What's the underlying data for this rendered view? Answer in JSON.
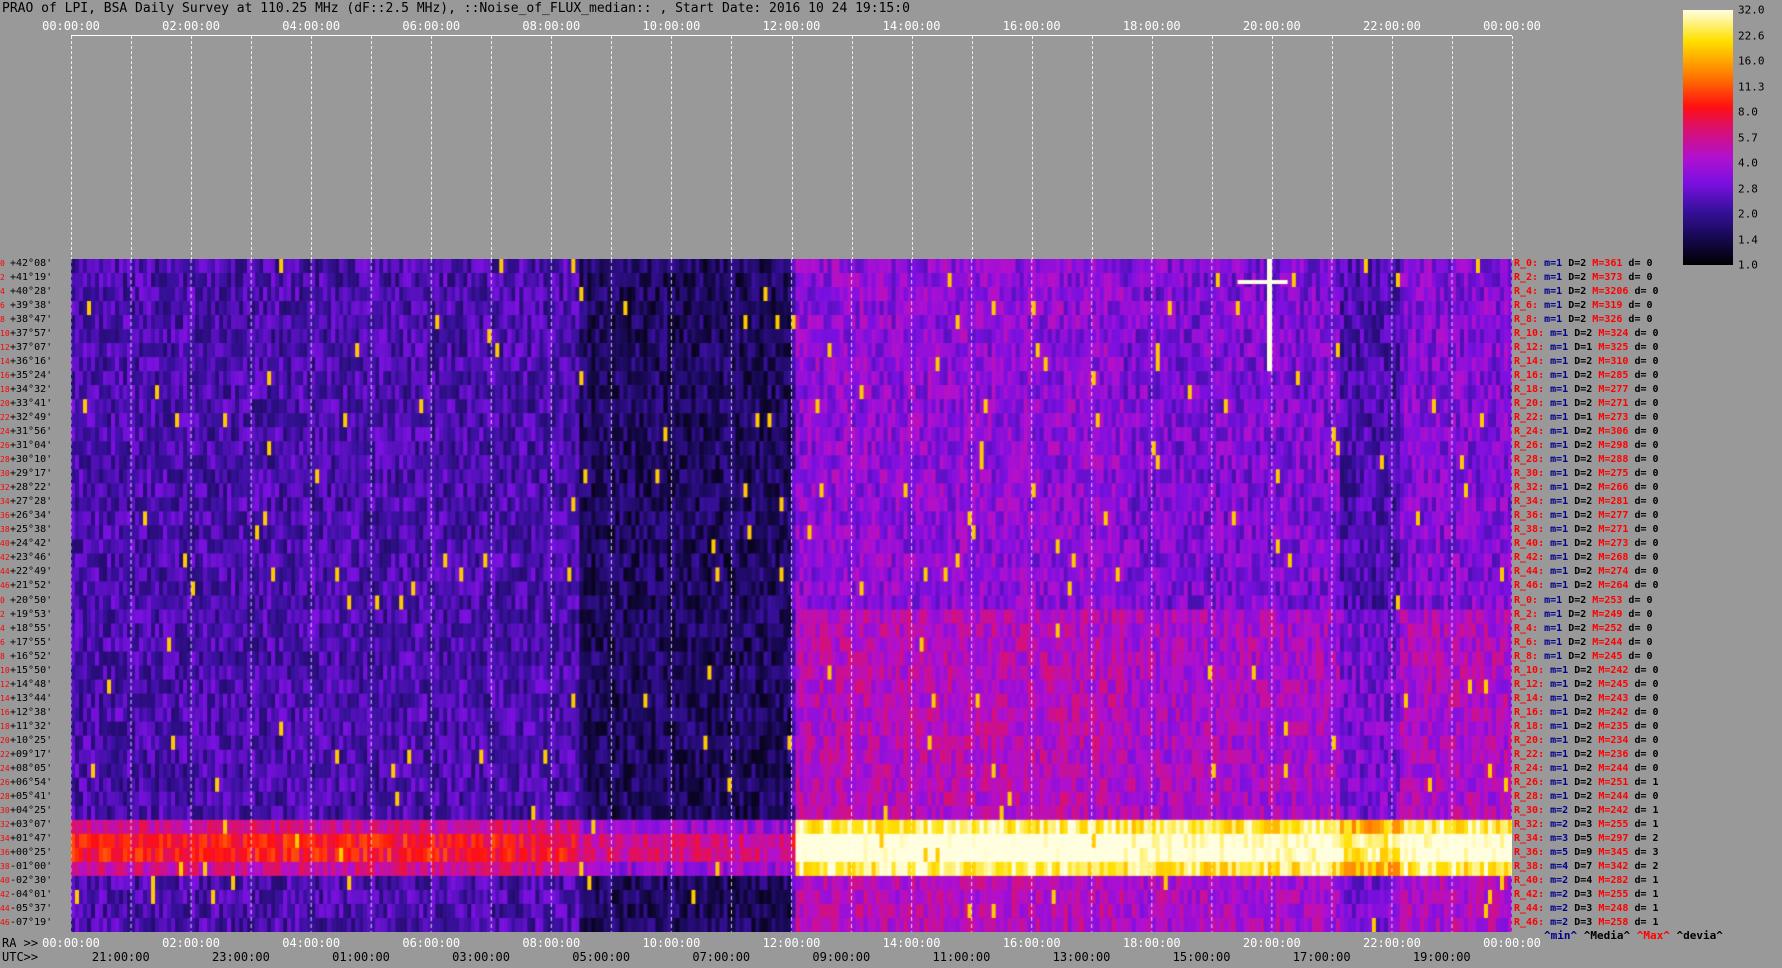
{
  "title": "PRAO of LPI, BSA Daily Survey at 110.25 MHz (dF::2.5 MHz), ::Noise_of_FLUX_median:: , Start Date: 2016 10 24 19:15:0",
  "chart_data": {
    "type": "heatmap",
    "x_ra_ticks": [
      "00:00:00",
      "02:00:00",
      "04:00:00",
      "06:00:00",
      "08:00:00",
      "10:00:00",
      "12:00:00",
      "14:00:00",
      "16:00:00",
      "18:00:00",
      "20:00:00",
      "22:00:00",
      "00:00:00"
    ],
    "x_utc_ticks": [
      "21:00:00",
      "23:00:00",
      "01:00:00",
      "03:00:00",
      "05:00:00",
      "07:00:00",
      "09:00:00",
      "11:00:00",
      "13:00:00",
      "15:00:00",
      "17:00:00",
      "19:00:00"
    ],
    "ra_label": "RA >>",
    "utc_label": "UTC>>",
    "declinations": [
      "+42°08'",
      "+41°19'",
      "+40°28'",
      "+39°38'",
      "+38°47'",
      "+37°57'",
      "+37°07'",
      "+36°16'",
      "+35°24'",
      "+34°32'",
      "+33°41'",
      "+32°49'",
      "+31°56'",
      "+31°04'",
      "+30°10'",
      "+29°17'",
      "+28°22'",
      "+27°28'",
      "+26°34'",
      "+25°38'",
      "+24°42'",
      "+23°46'",
      "+22°49'",
      "+21°52'",
      "+20°50'",
      "+19°53'",
      "+18°55'",
      "+17°55'",
      "+16°52'",
      "+15°50'",
      "+14°48'",
      "+13°44'",
      "+12°38'",
      "+11°32'",
      "+10°25'",
      "+09°17'",
      "+08°05'",
      "+06°54'",
      "+05°41'",
      "+04°25'",
      "+03°07'",
      "+01°47'",
      "+00°25'",
      "-01°00'",
      "-02°30'",
      "-04°01'",
      "-05°37'",
      "-07°19'"
    ],
    "row_numbers": [
      "0",
      "2",
      "4",
      "6",
      "8",
      "10",
      "12",
      "14",
      "16",
      "18",
      "20",
      "22",
      "24",
      "26",
      "28",
      "30",
      "32",
      "34",
      "36",
      "38",
      "40",
      "42",
      "44",
      "46",
      "0",
      "2",
      "4",
      "6",
      "8",
      "10",
      "12",
      "14",
      "16",
      "18",
      "20",
      "22",
      "24",
      "26",
      "28",
      "30",
      "32",
      "34",
      "36",
      "38",
      "40",
      "42",
      "44",
      "46"
    ],
    "row_stats": [
      {
        "r": "R_0:",
        "m": "m=1",
        "d": "D=2",
        "M": "M=361",
        "dev": "d= 0"
      },
      {
        "r": "R_2:",
        "m": "m=1",
        "d": "D=2",
        "M": "M=373",
        "dev": "d= 0"
      },
      {
        "r": "R_4:",
        "m": "m=1",
        "d": "D=2",
        "M": "M=3206",
        "dev": "d= 0"
      },
      {
        "r": "R_6:",
        "m": "m=1",
        "d": "D=2",
        "M": "M=319",
        "dev": "d= 0"
      },
      {
        "r": "R_8:",
        "m": "m=1",
        "d": "D=2",
        "M": "M=326",
        "dev": "d= 0"
      },
      {
        "r": "R_10:",
        "m": "m=1",
        "d": "D=2",
        "M": "M=324",
        "dev": "d= 0"
      },
      {
        "r": "R_12:",
        "m": "m=1",
        "d": "D=1",
        "M": "M=325",
        "dev": "d= 0"
      },
      {
        "r": "R_14:",
        "m": "m=1",
        "d": "D=2",
        "M": "M=310",
        "dev": "d= 0"
      },
      {
        "r": "R_16:",
        "m": "m=1",
        "d": "D=2",
        "M": "M=285",
        "dev": "d= 0"
      },
      {
        "r": "R_18:",
        "m": "m=1",
        "d": "D=2",
        "M": "M=277",
        "dev": "d= 0"
      },
      {
        "r": "R_20:",
        "m": "m=1",
        "d": "D=2",
        "M": "M=271",
        "dev": "d= 0"
      },
      {
        "r": "R_22:",
        "m": "m=1",
        "d": "D=1",
        "M": "M=273",
        "dev": "d= 0"
      },
      {
        "r": "R_24:",
        "m": "m=1",
        "d": "D=2",
        "M": "M=306",
        "dev": "d= 0"
      },
      {
        "r": "R_26:",
        "m": "m=1",
        "d": "D=2",
        "M": "M=298",
        "dev": "d= 0"
      },
      {
        "r": "R_28:",
        "m": "m=1",
        "d": "D=2",
        "M": "M=288",
        "dev": "d= 0"
      },
      {
        "r": "R_30:",
        "m": "m=1",
        "d": "D=2",
        "M": "M=275",
        "dev": "d= 0"
      },
      {
        "r": "R_32:",
        "m": "m=1",
        "d": "D=2",
        "M": "M=266",
        "dev": "d= 0"
      },
      {
        "r": "R_34:",
        "m": "m=1",
        "d": "D=2",
        "M": "M=281",
        "dev": "d= 0"
      },
      {
        "r": "R_36:",
        "m": "m=1",
        "d": "D=2",
        "M": "M=277",
        "dev": "d= 0"
      },
      {
        "r": "R_38:",
        "m": "m=1",
        "d": "D=2",
        "M": "M=271",
        "dev": "d= 0"
      },
      {
        "r": "R_40:",
        "m": "m=1",
        "d": "D=2",
        "M": "M=273",
        "dev": "d= 0"
      },
      {
        "r": "R_42:",
        "m": "m=1",
        "d": "D=2",
        "M": "M=268",
        "dev": "d= 0"
      },
      {
        "r": "R_44:",
        "m": "m=1",
        "d": "D=2",
        "M": "M=274",
        "dev": "d= 0"
      },
      {
        "r": "R_46:",
        "m": "m=1",
        "d": "D=2",
        "M": "M=264",
        "dev": "d= 0"
      },
      {
        "r": "R_0:",
        "m": "m=1",
        "d": "D=2",
        "M": "M=253",
        "dev": "d= 0"
      },
      {
        "r": "R_2:",
        "m": "m=1",
        "d": "D=2",
        "M": "M=249",
        "dev": "d= 0"
      },
      {
        "r": "R_4:",
        "m": "m=1",
        "d": "D=2",
        "M": "M=252",
        "dev": "d= 0"
      },
      {
        "r": "R_6:",
        "m": "m=1",
        "d": "D=2",
        "M": "M=244",
        "dev": "d= 0"
      },
      {
        "r": "R_8:",
        "m": "m=1",
        "d": "D=2",
        "M": "M=245",
        "dev": "d= 0"
      },
      {
        "r": "R_10:",
        "m": "m=1",
        "d": "D=2",
        "M": "M=242",
        "dev": "d= 0"
      },
      {
        "r": "R_12:",
        "m": "m=1",
        "d": "D=2",
        "M": "M=245",
        "dev": "d= 0"
      },
      {
        "r": "R_14:",
        "m": "m=1",
        "d": "D=2",
        "M": "M=243",
        "dev": "d= 0"
      },
      {
        "r": "R_16:",
        "m": "m=1",
        "d": "D=2",
        "M": "M=242",
        "dev": "d= 0"
      },
      {
        "r": "R_18:",
        "m": "m=1",
        "d": "D=2",
        "M": "M=235",
        "dev": "d= 0"
      },
      {
        "r": "R_20:",
        "m": "m=1",
        "d": "D=2",
        "M": "M=234",
        "dev": "d= 0"
      },
      {
        "r": "R_22:",
        "m": "m=1",
        "d": "D=2",
        "M": "M=236",
        "dev": "d= 0"
      },
      {
        "r": "R_24:",
        "m": "m=1",
        "d": "D=2",
        "M": "M=244",
        "dev": "d= 0"
      },
      {
        "r": "R_26:",
        "m": "m=1",
        "d": "D=2",
        "M": "M=251",
        "dev": "d= 1"
      },
      {
        "r": "R_28:",
        "m": "m=1",
        "d": "D=2",
        "M": "M=244",
        "dev": "d= 0"
      },
      {
        "r": "R_30:",
        "m": "m=2",
        "d": "D=2",
        "M": "M=242",
        "dev": "d= 1"
      },
      {
        "r": "R_32:",
        "m": "m=2",
        "d": "D=3",
        "M": "M=255",
        "dev": "d= 1"
      },
      {
        "r": "R_34:",
        "m": "m=3",
        "d": "D=5",
        "M": "M=297",
        "dev": "d= 2"
      },
      {
        "r": "R_36:",
        "m": "m=5",
        "d": "D=9",
        "M": "M=345",
        "dev": "d= 3"
      },
      {
        "r": "R_38:",
        "m": "m=4",
        "d": "D=7",
        "M": "M=342",
        "dev": "d= 2"
      },
      {
        "r": "R_40:",
        "m": "m=2",
        "d": "D=4",
        "M": "M=282",
        "dev": "d= 1"
      },
      {
        "r": "R_42:",
        "m": "m=2",
        "d": "D=3",
        "M": "M=255",
        "dev": "d= 1"
      },
      {
        "r": "R_44:",
        "m": "m=2",
        "d": "D=3",
        "M": "M=248",
        "dev": "d= 1"
      },
      {
        "r": "R_46:",
        "m": "m=2",
        "d": "D=3",
        "M": "M=258",
        "dev": "d= 1"
      }
    ],
    "colorbar_ticks": [
      "32.0",
      "22.6",
      "16.0",
      "11.3",
      "8.0",
      "5.7",
      "4.0",
      "2.8",
      "2.0",
      "1.4",
      "1.0"
    ],
    "legend": {
      "min": "^min^",
      "media": "^Media^",
      "max": "^Max^",
      "devia": "^devia^"
    }
  }
}
